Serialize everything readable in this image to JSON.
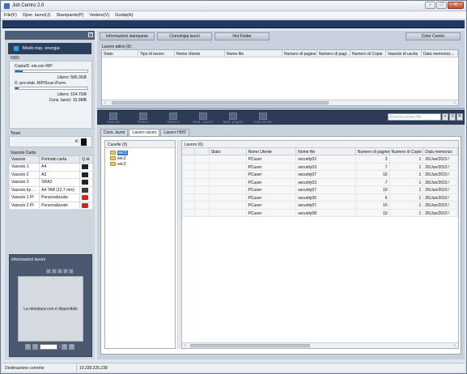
{
  "window": {
    "title": "Job Centro 2.0",
    "minimize": "–",
    "maximize": "□",
    "close": "✕"
  },
  "menu": [
    "File(F)",
    "Oper. lavori(J)",
    "Stampante(P)",
    "Vedere(V)",
    "Guida(H)"
  ],
  "left_panel": {
    "pin": "×",
    "power_label": "Modo risp. energia",
    "hdd": {
      "label": "HDD",
      "copy_label": "Copia/D. ela.con RIP",
      "copy_free": "Libero: 586.3GB",
      "copy_fill": 0.1,
      "prerip_label": "D. pre-elab. RIP/Scan./Form.",
      "prerip_free": "Libero: 164.7GB",
      "prerip_fill": 0.05,
      "cons_jobs": "Cons. lavori: 10.0MB"
    },
    "toner": {
      "label": "Toner",
      "k_label": "K:",
      "k_color": "#111111"
    },
    "trays": {
      "label": "Vassoio Carta",
      "headers": [
        "Vassoio",
        "Formato carta",
        "Q.tà"
      ],
      "rows": [
        {
          "tray": "Vassoio 1",
          "format": "A4",
          "qty": "black"
        },
        {
          "tray": "Vassoio 2",
          "format": "A3",
          "qty": "black"
        },
        {
          "tray": "Vassoio 3",
          "format": "SRA3",
          "qty": "black"
        },
        {
          "tray": "Vassoio by…",
          "format": "A4 TAB (12.7 mm)",
          "qty": "dark"
        },
        {
          "tray": "Vassoio 1 PI",
          "format": "Personalizzato",
          "qty": "red"
        },
        {
          "tray": "Vassoio 2 PI",
          "format": "Personalizzato",
          "qty": "red"
        }
      ]
    },
    "job_info": {
      "label": "Informazioni lavoro",
      "thumbnail_text": "La miniatura non è disponibile",
      "page_sep": "/",
      "first": "«",
      "prev": "‹",
      "next": "›",
      "last": "»"
    }
  },
  "tabs_top": [
    "Informazioni stampante",
    "Cronologia lavori",
    "Hot Folder",
    "Color Centro"
  ],
  "active_jobs": {
    "label": "Lavoro attivo (0)",
    "headers": [
      "Stato",
      "Tipo di lavoro",
      "Nome Utente",
      "Nome file",
      "Numero di pagine",
      "Numero di pagi…",
      "Numero di Copie",
      "Vassoio di uscita",
      "Data memorizz…"
    ],
    "left_arrow": "‹",
    "right_arrow": "›"
  },
  "toolbar": {
    "buttons": [
      "Stampa",
      "Rilievo",
      "Elimina",
      "Mod. Lavoro",
      "Mod. pagina",
      "Invia Orcan."
    ],
    "search_placeholder": "Ricerca nome file",
    "search_btn": "⌕",
    "options_btn": "≡",
    "close_btn": "✕"
  },
  "lower_tabs": [
    "Cons. lavori",
    "Lavoro sicuro",
    "Lavoro HDD"
  ],
  "caselle": {
    "label": "Caselle (0)",
    "items": [
      "sec1",
      "sec2",
      "sec3"
    ]
  },
  "lavoro": {
    "label": "Lavoro (0)",
    "headers": [
      "",
      "",
      "Stato",
      "Nome Utente",
      "Nome file",
      "Numero di pagine",
      "Numero di Copie",
      "Data memorizz"
    ],
    "rows": [
      {
        "user": "PCuser",
        "file": "security02",
        "pages": "3",
        "copies": "1",
        "date": "26/Jun/2015 !"
      },
      {
        "user": "PCuser",
        "file": "security03",
        "pages": "7",
        "copies": "1",
        "date": "26/Jun/2015 !"
      },
      {
        "user": "PCuser",
        "file": "security07",
        "pages": "10",
        "copies": "1",
        "date": "26/Jun/2015 !"
      },
      {
        "user": "PCuser",
        "file": "security03",
        "pages": "7",
        "copies": "1",
        "date": "26/Jun/2015 !"
      },
      {
        "user": "PCuser",
        "file": "security07",
        "pages": "10",
        "copies": "1",
        "date": "26/Jun/2015 !"
      },
      {
        "user": "PCuser",
        "file": "security06",
        "pages": "6",
        "copies": "1",
        "date": "26/Jun/2015 !"
      },
      {
        "user": "PCuser",
        "file": "security07",
        "pages": "10",
        "copies": "1",
        "date": "26/Jun/2015 !"
      },
      {
        "user": "PCuser",
        "file": "security08",
        "pages": "10",
        "copies": "1",
        "date": "26/Jun/2015 !"
      }
    ],
    "left_arrow": "‹",
    "right_arrow": "›"
  },
  "status": {
    "label": "Destinazione corrente",
    "value": "10.239.225.238"
  }
}
